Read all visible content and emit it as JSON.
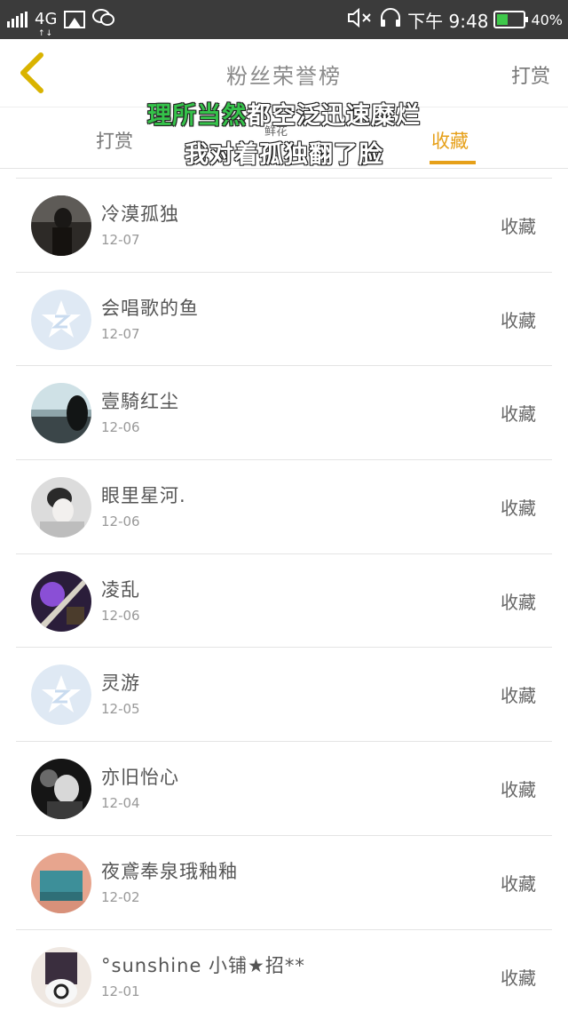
{
  "status_bar": {
    "network": "4G",
    "network_arrows": "↑↓",
    "time": "下午 9:48",
    "battery": "40%",
    "battery_level": 0.4,
    "icons": [
      "signal-icon",
      "image-icon",
      "wechat-icon",
      "mute-icon",
      "headset-icon",
      "battery-icon"
    ]
  },
  "nav": {
    "back_icon": "chevron-left-icon",
    "title": "粉丝荣誉榜",
    "right_action": "打赏",
    "accent_color": "#d9b300"
  },
  "overlay": {
    "line1_green": "理所当然",
    "line1_rest": "都空泛迅速糜烂",
    "line2": "我对着孤独翻了脸"
  },
  "tabs": {
    "items": [
      "打赏",
      "鲜花",
      "收藏"
    ],
    "active": "收藏",
    "active_color": "#e6a019"
  },
  "list": {
    "action_label": "收藏",
    "rows": [
      {
        "name": "冷漠孤独",
        "date": "12-07",
        "avatar": "photo"
      },
      {
        "name": "会唱歌的鱼",
        "date": "12-07",
        "avatar": "default-qq-icon"
      },
      {
        "name": "壹騎红尘",
        "date": "12-06",
        "avatar": "photo"
      },
      {
        "name": "眼里星河.",
        "date": "12-06",
        "avatar": "photo"
      },
      {
        "name": "凌乱",
        "date": "12-06",
        "avatar": "photo"
      },
      {
        "name": "灵游",
        "date": "12-05",
        "avatar": "default-qq-icon"
      },
      {
        "name": "亦旧怡心",
        "date": "12-04",
        "avatar": "photo"
      },
      {
        "name": "夜鳶奉泉珴釉釉",
        "date": "12-02",
        "avatar": "photo"
      },
      {
        "name": "°sunshine 小铺★招**",
        "date": "12-01",
        "avatar": "photo"
      }
    ]
  }
}
